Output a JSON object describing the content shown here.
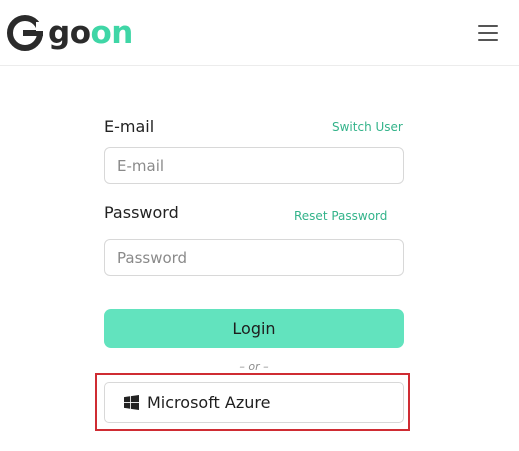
{
  "header": {
    "logo": {
      "part1": "go",
      "part2": "on",
      "mark_icon": "goon-g-logo-icon"
    },
    "menu_icon": "hamburger-menu-icon"
  },
  "form": {
    "email": {
      "label": "E-mail",
      "placeholder": "E-mail",
      "value": "",
      "side_link": "Switch User"
    },
    "password": {
      "label": "Password",
      "placeholder": "Password",
      "value": "",
      "side_link": "Reset Password"
    },
    "login_label": "Login",
    "divider_text": "– or –",
    "sso": {
      "label": "Microsoft Azure",
      "icon": "windows-icon"
    }
  },
  "colors": {
    "brand_accent": "#3fd6a6",
    "button_fill": "#62e3be",
    "link": "#33b38a",
    "highlight": "#cf2c33"
  }
}
